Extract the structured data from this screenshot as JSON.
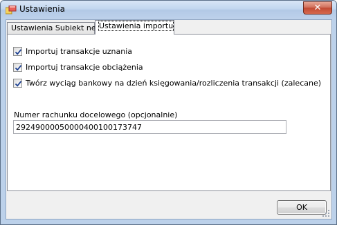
{
  "window": {
    "title": "Ustawienia",
    "close_glyph": "✕",
    "app_icon": "app-window-icon"
  },
  "tabs": [
    {
      "label": "Ustawienia Subiekt nexo",
      "selected": false
    },
    {
      "label": "Ustawienia importu",
      "selected": true
    }
  ],
  "options": [
    {
      "label": "Importuj transakcje uznania",
      "checked": true
    },
    {
      "label": "Importuj transakcje obciążenia",
      "checked": true
    },
    {
      "label": "Twórz wyciąg bankowy na dzień księgowania/rozliczenia transakcji (zalecane)",
      "checked": true
    }
  ],
  "account": {
    "label": "Numer rachunku docelowego (opcjonalnie)",
    "value": "29249000050000400100173747"
  },
  "buttons": {
    "ok_label": "OK"
  },
  "colors": {
    "check": "#1b3f91",
    "close_button": "#c24a33"
  }
}
